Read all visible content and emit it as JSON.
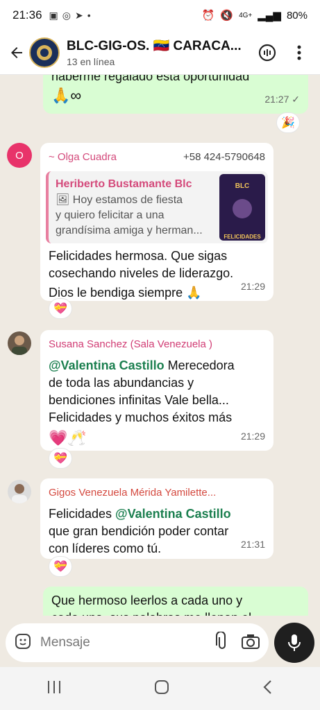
{
  "status_bar": {
    "time": "21:36",
    "battery": "80%",
    "network": "4G+"
  },
  "header": {
    "title": "BLC-GIG-OS. 🇻🇪 CARACA...",
    "subtitle": "13 en línea"
  },
  "messages": {
    "m1": {
      "text": "haberme regalado esta oportunidad",
      "emoji": "🙏∞",
      "time": "21:27",
      "tick": "✓",
      "reaction": "🎉"
    },
    "m2": {
      "avatar_letter": "O",
      "sender": "~ Olga Cuadra",
      "phone": "+58 424-5790648",
      "quote_name": "Heriberto Bustamante Blc",
      "quote_line1": "Hoy estamos de fiesta",
      "quote_line2": "y quiero felicitar a una",
      "quote_line3": "grandísima amiga y herman...",
      "quote_image_text1": "BLC",
      "quote_image_text2": "FELICIDADES",
      "line1": "Felicidades hermosa. Que sigas",
      "line2": "cosechando niveles de liderazgo.",
      "line3": "Dios le bendiga siempre 🙏",
      "time": "21:29",
      "reaction": "💝"
    },
    "m3": {
      "sender": "Susana Sanchez (Sala Venezuela )",
      "mention": "@Valentina Castillo",
      "line1": " Merecedora",
      "line2": "de toda las abundancias y",
      "line3": "bendiciones infinitas Vale bella...",
      "line4": "Felicidades y muchos éxitos más",
      "line5": "💗🥂",
      "time": "21:29",
      "reaction": "💝"
    },
    "m4": {
      "sender": "Gigos Venezuela Mérida Yamilette...",
      "prefix": "Felicidades ",
      "mention": "@Valentina Castillo",
      "line2": "que gran bendición poder contar",
      "line3": "con líderes como tú.",
      "time": "21:31",
      "reaction": "💝"
    },
    "m5": {
      "line1": "Que hermoso leerlos a cada uno y",
      "line2": "cada una, sus palabras me llenan el"
    }
  },
  "input": {
    "placeholder": "Mensaje"
  },
  "colors": {
    "out_bubble": "#d9fdd3",
    "in_bubble": "#ffffff",
    "bg": "#efeae2",
    "mention": "#1b7f4f"
  }
}
